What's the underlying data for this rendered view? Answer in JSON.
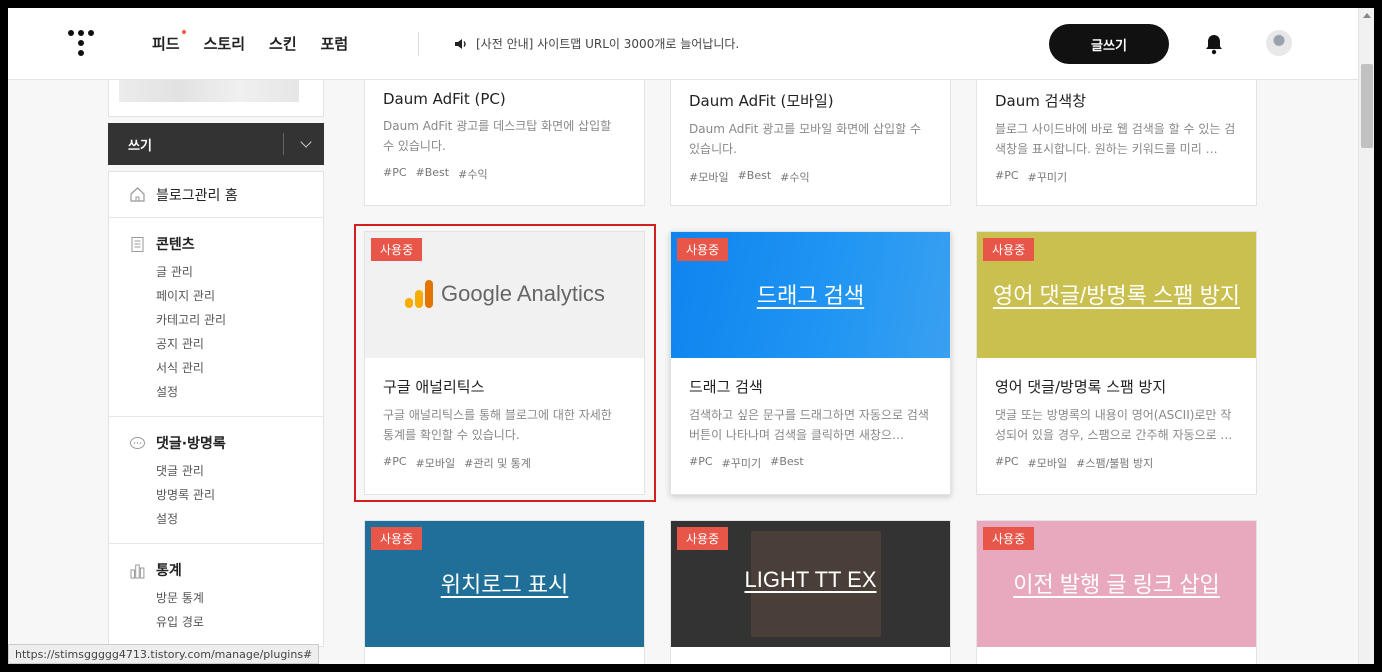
{
  "topbar": {
    "nav": [
      "피드",
      "스토리",
      "스킨",
      "포럼"
    ],
    "notice": "[사전 안내] 사이트맵 URL이 3000개로 늘어납니다.",
    "write_label": "글쓰기"
  },
  "sidebar": {
    "write_dropdown": "쓰기",
    "home": "블로그관리 홈",
    "sections": [
      {
        "title": "콘텐츠",
        "items": [
          "글 관리",
          "페이지 관리",
          "카테고리 관리",
          "공지 관리",
          "서식 관리",
          "설정"
        ]
      },
      {
        "title": "댓글·방명록",
        "items": [
          "댓글 관리",
          "방명록 관리",
          "설정"
        ]
      },
      {
        "title": "통계",
        "items": [
          "방문 통계",
          "유입 경로"
        ]
      }
    ]
  },
  "badge_text": "사용중",
  "cards_top": [
    {
      "title": "Daum AdFit (PC)",
      "desc": "Daum AdFit 광고를 데스크탑 화면에 삽입할 수 있습니다.",
      "tags": [
        "#PC",
        "#Best",
        "#수익"
      ]
    },
    {
      "title": "Daum AdFit (모바일)",
      "desc": "Daum AdFit 광고를 모바일 화면에 삽입할 수 있습니다.",
      "tags": [
        "#모바일",
        "#Best",
        "#수익"
      ]
    },
    {
      "title": "Daum 검색창",
      "desc": "블로그 사이드바에 바로 웹 검색을 할 수 있는 검색창을 표시합니다. 원하는 키워드를 미리 …",
      "tags": [
        "#PC",
        "#꾸미기"
      ]
    }
  ],
  "cards_mid": [
    {
      "title": "구글 애널리틱스",
      "thumb_label": "Google Analytics",
      "desc": "구글 애널리틱스를 통해 블로그에 대한 자세한 통계를 확인할 수 있습니다.",
      "tags": [
        "#PC",
        "#모바일",
        "#관리 및 통계"
      ]
    },
    {
      "title": "드래그 검색",
      "thumb_label": "드래그 검색",
      "desc": "검색하고 싶은 문구를 드래그하면 자동으로 검색 버튼이 나타나며 검색을 클릭하면 새창으…",
      "tags": [
        "#PC",
        "#꾸미기",
        "#Best"
      ]
    },
    {
      "title": "영어 댓글/방명록 스팸 방지",
      "thumb_label": "영어 댓글/방명록 스팸 방지",
      "desc": "댓글 또는 방명록의 내용이 영어(ASCII)로만 작성되어 있을 경우, 스팸으로 간주해 자동으로 …",
      "tags": [
        "#PC",
        "#모바일",
        "#스팸/불펌 방지"
      ]
    }
  ],
  "cards_bottom": [
    {
      "thumb_label": "위치로그 표시"
    },
    {
      "thumb_label": "LIGHT TT EX"
    },
    {
      "thumb_label": "이전 발행 글 링크 삽입"
    }
  ],
  "colors": {
    "badge": "#e8564a",
    "selected_border": "#d21f1f",
    "drag_thumb": "#1a8cf0",
    "spam_thumb": "#c9c04f",
    "location_thumb": "#1f6f9a",
    "light_thumb": "#333333",
    "prev_thumb": "#e8a8be"
  },
  "status_url": "https://stimsggggg4713.tistory.com/manage/plugins#"
}
